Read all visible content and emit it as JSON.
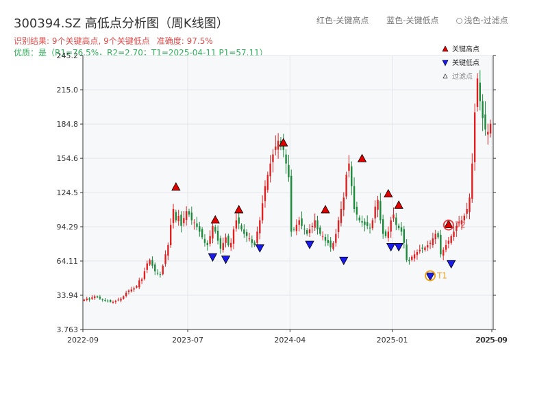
{
  "header": {
    "title": "300394.SZ 高低点分析图（周K线图）",
    "legend_red": "红色-关键高点",
    "legend_blue": "蓝色-关键低点",
    "legend_light": "浅色-过滤点",
    "result": "识别结果: 9个关键高点, 9个关键低点",
    "accuracy": "准确度: 97.5%",
    "quality": "优质：是（R1=76.5%，R2=2.70；T1=2025-04-11 P1=57.11）"
  },
  "chart_data": {
    "type": "candlestick",
    "ylim": [
      3.763,
      245.2
    ],
    "yticks": [
      3.763,
      33.94,
      64.11,
      94.29,
      124.5,
      154.6,
      184.8,
      215.0,
      245.2
    ],
    "ytick_labels": [
      "3.763",
      "33.94",
      "64.11",
      "94.29",
      "124.5",
      "154.6",
      "184.8",
      "215.0",
      "245.2"
    ],
    "xticks": [
      "2022-09",
      "2023-07",
      "2024-04",
      "2025-01",
      "2025-09"
    ],
    "xtick_extra": "2025-09",
    "xlim_weeks": 156,
    "xtick_weeks": [
      0,
      40,
      79,
      118,
      156
    ],
    "legend": {
      "high": "关键高点",
      "low": "关键低点",
      "filtered": "过滤点"
    },
    "colors": {
      "up": "#e02020",
      "down": "#1a8a3a",
      "high": "#e00000",
      "low": "#1a1aee",
      "t1": "#f0a020",
      "t2": "#e84040",
      "bg": "#f7f8fa"
    },
    "closes": [
      30,
      31,
      30,
      32,
      33,
      32,
      31,
      30,
      29,
      29,
      28,
      28,
      29,
      30,
      31,
      33,
      36,
      38,
      39,
      40,
      42,
      47,
      48,
      55,
      62,
      65,
      60,
      55,
      53,
      52,
      60,
      70,
      78,
      96,
      110,
      100,
      104,
      95,
      102,
      108,
      105,
      100,
      98,
      94,
      90,
      85,
      80,
      78,
      86,
      95,
      90,
      82,
      75,
      80,
      85,
      78,
      80,
      92,
      100,
      97,
      92,
      88,
      86,
      84,
      80,
      78,
      90,
      100,
      115,
      130,
      140,
      150,
      158,
      165,
      170,
      165,
      162,
      150,
      138,
      90,
      92,
      96,
      100,
      95,
      92,
      88,
      92,
      95,
      100,
      92,
      88,
      86,
      82,
      80,
      76,
      80,
      88,
      100,
      110,
      120,
      140,
      150,
      130,
      110,
      105,
      100,
      98,
      96,
      95,
      93,
      100,
      112,
      118,
      100,
      88,
      86,
      90,
      100,
      105,
      96,
      93,
      90,
      80,
      65,
      64,
      68,
      70,
      72,
      74,
      75,
      76,
      78,
      80,
      84,
      88,
      85,
      70,
      74,
      78,
      82,
      86,
      90,
      95,
      98,
      100,
      104,
      110,
      120,
      150,
      195,
      225,
      205,
      190,
      180,
      178,
      185
    ],
    "highs": [
      {
        "w": 35,
        "p": 124
      },
      {
        "w": 50,
        "p": 95
      },
      {
        "w": 59,
        "p": 104
      },
      {
        "w": 76,
        "p": 163
      },
      {
        "w": 92,
        "p": 104
      },
      {
        "w": 106,
        "p": 149
      },
      {
        "w": 116,
        "p": 118
      },
      {
        "w": 120,
        "p": 108
      },
      {
        "w": 139,
        "p": 91
      }
    ],
    "lows": [
      {
        "w": 49,
        "p": 73
      },
      {
        "w": 54,
        "p": 71
      },
      {
        "w": 67,
        "p": 81
      },
      {
        "w": 86,
        "p": 84
      },
      {
        "w": 99,
        "p": 70
      },
      {
        "w": 117,
        "p": 82
      },
      {
        "w": 120,
        "p": 82
      },
      {
        "w": 132,
        "p": 56
      },
      {
        "w": 140,
        "p": 67
      }
    ],
    "t1": {
      "w": 132,
      "p": 56,
      "label": "T1"
    },
    "t2": {
      "w": 139,
      "p": 91,
      "label": "T2"
    }
  }
}
